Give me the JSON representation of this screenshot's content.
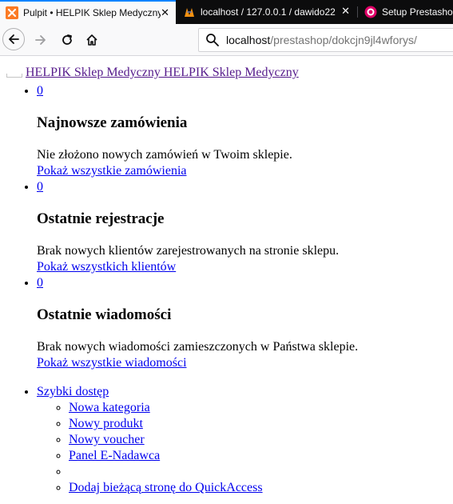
{
  "browser": {
    "tabs": [
      {
        "title": "Pulpit • HELPIK Sklep Medyczny",
        "close": "✕",
        "icon": "xampp-icon",
        "active": true
      },
      {
        "title": "localhost / 127.0.0.1 / dawido22",
        "close": "✕",
        "icon": "phpmyadmin-icon",
        "active": false
      },
      {
        "title": "Setup Prestashop",
        "icon": "prestashop-icon",
        "active": false
      }
    ],
    "url_host": "localhost",
    "url_path": "/prestashop/dokcjn9jl4wforys/"
  },
  "page": {
    "shop_name_link": "HELPIK Sklep Medyczny HELPIK Sklep Medyczny",
    "sections": [
      {
        "count": "0",
        "heading": "Najnowsze zamówienia",
        "message": "Nie złożono nowych zamówień w Twoim sklepie.",
        "link": "Pokaż wszystkie zamówienia"
      },
      {
        "count": "0",
        "heading": "Ostatnie rejestracje",
        "message": "Brak nowych klientów zarejestrowanych na stronie sklepu.",
        "link": "Pokaż wszystkich klientów"
      },
      {
        "count": "0",
        "heading": "Ostatnie wiadomości",
        "message": "Brak nowych wiadomości zamieszczonych w Państwa sklepie.",
        "link": "Pokaż wszystkie wiadomości"
      }
    ],
    "quick_access": {
      "label": "Szybki dostęp",
      "items": [
        "Nowa kategoria",
        "Nowy produkt",
        "Nowy voucher",
        "Panel E-Nadawca",
        "",
        "Dodaj bieżącą stronę do QuickAccess"
      ]
    }
  }
}
